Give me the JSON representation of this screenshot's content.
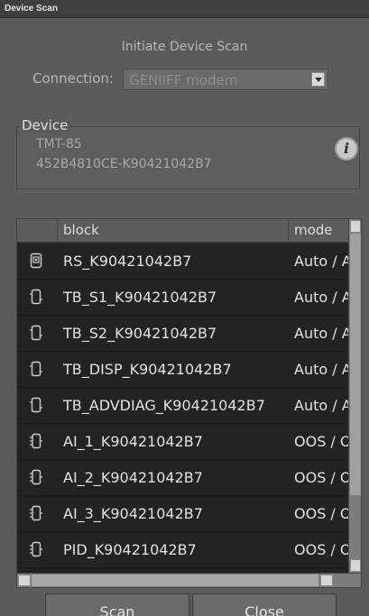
{
  "window": {
    "title": "Device Scan"
  },
  "header": {
    "subtitle": "Initiate Device Scan"
  },
  "connection": {
    "label": "Connection:",
    "value": "GENIIFF modem"
  },
  "device": {
    "legend": "Device",
    "model": "TMT-85",
    "id": "452B4810CE-K90421042B7"
  },
  "table": {
    "columns": [
      "block",
      "mode"
    ],
    "rows": [
      {
        "icon": "resource-block-icon",
        "block": "RS_K90421042B7",
        "mode": "Auto / Auto"
      },
      {
        "icon": "transducer-block-icon",
        "block": "TB_S1_K90421042B7",
        "mode": "Auto / Auto"
      },
      {
        "icon": "transducer-block-icon",
        "block": "TB_S2_K90421042B7",
        "mode": "Auto / Auto"
      },
      {
        "icon": "transducer-block-icon",
        "block": "TB_DISP_K90421042B7",
        "mode": "Auto / Auto"
      },
      {
        "icon": "transducer-block-icon",
        "block": "TB_ADVDIAG_K90421042B7",
        "mode": "Auto / Auto"
      },
      {
        "icon": "function-block-icon",
        "block": "AI_1_K90421042B7",
        "mode": "OOS / OOS"
      },
      {
        "icon": "function-block-icon",
        "block": "AI_2_K90421042B7",
        "mode": "OOS / OOS"
      },
      {
        "icon": "function-block-icon",
        "block": "AI_3_K90421042B7",
        "mode": "OOS / OOS"
      },
      {
        "icon": "function-block-icon",
        "block": "PID_K90421042B7",
        "mode": "OOS / OOS"
      }
    ]
  },
  "buttons": {
    "scan": "Scan",
    "close": "Close"
  }
}
